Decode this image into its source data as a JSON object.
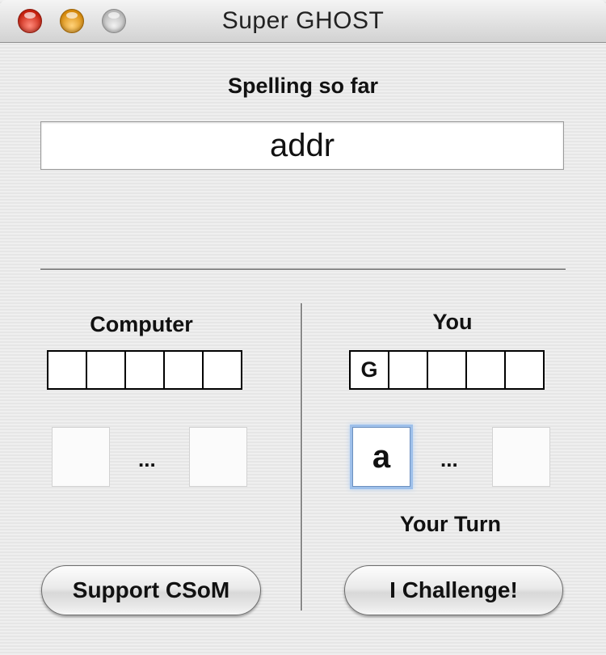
{
  "window": {
    "title": "Super GHOST"
  },
  "spelling": {
    "label": "Spelling so far",
    "value": "addr"
  },
  "computer": {
    "label": "Computer",
    "ghost_letters": [
      "",
      "",
      "",
      "",
      ""
    ],
    "slots": [
      "",
      ""
    ],
    "ellipsis": "..."
  },
  "player": {
    "label": "You",
    "ghost_letters": [
      "G",
      "",
      "",
      "",
      ""
    ],
    "slots": [
      "a",
      ""
    ],
    "ellipsis": "...",
    "status": "Your Turn"
  },
  "buttons": {
    "support": "Support CSoM",
    "challenge": "I Challenge!"
  }
}
